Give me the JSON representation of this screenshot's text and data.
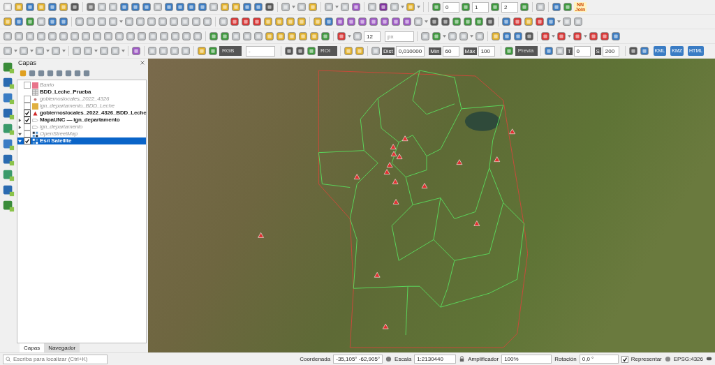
{
  "toolbars": {
    "row_1": {
      "widgets": [
        {
          "kind": "spin",
          "value": "0"
        },
        {
          "kind": "spin",
          "value": "1"
        },
        {
          "kind": "spin",
          "value": "2"
        },
        {
          "kind": "logo",
          "value": "NN Join"
        }
      ]
    },
    "row_3": {
      "widgets": [
        {
          "kind": "spin",
          "value": "12"
        },
        {
          "kind": "combo",
          "value": "px"
        }
      ]
    },
    "row_4": {
      "widgets": [
        {
          "kind": "darkcombo",
          "value": "RGB"
        },
        {
          "kind": "combo",
          "value": "-"
        },
        {
          "kind": "darkbox",
          "value": "ROI"
        },
        {
          "kind": "spin",
          "label": "Dist",
          "value": "0,010000"
        },
        {
          "kind": "spin",
          "label": "Mín",
          "value": "60"
        },
        {
          "kind": "spin",
          "label": "Máx",
          "value": "100"
        },
        {
          "kind": "darkcombo",
          "value": "Previa"
        },
        {
          "kind": "spin",
          "label": "T",
          "value": "0"
        },
        {
          "kind": "spin",
          "label": "S",
          "value": "200"
        },
        {
          "kind": "tagicon",
          "value": "KML"
        },
        {
          "kind": "tagicon",
          "value": "KMZ"
        },
        {
          "kind": "tagicon",
          "value": "HTML"
        }
      ]
    }
  },
  "layers_panel": {
    "title": "Capas",
    "layers": [
      {
        "name": "Barrio",
        "kind": "polygon",
        "color": "#e8748a",
        "visible": false,
        "active": false,
        "expandable": false,
        "selected": false
      },
      {
        "name": "BDD_Leche_Prueba",
        "kind": "table",
        "active": true,
        "expandable": false,
        "selected": false
      },
      {
        "name": "gobiernoslocales_2022_4326",
        "kind": "point",
        "color": "#c07a7a",
        "visible": false,
        "active": false,
        "expandable": false,
        "selected": false
      },
      {
        "name": "ign_departamento_BDD_Leche",
        "kind": "polygon",
        "color": "#e0b040",
        "visible": false,
        "active": false,
        "expandable": false,
        "selected": false
      },
      {
        "name": "gobiernoslocales_2022_4326_BDD_Leche",
        "kind": "triangle",
        "color": "#d02828",
        "visible": true,
        "active": true,
        "expandable": false,
        "selected": false
      },
      {
        "name": "MapaUNC — ign_departamento",
        "kind": "wms",
        "visible": true,
        "active": true,
        "expandable": true,
        "expanded": false,
        "selected": false
      },
      {
        "name": "ign_departamento",
        "kind": "wms",
        "visible": false,
        "active": false,
        "expandable": true,
        "expanded": false,
        "selected": false
      },
      {
        "name": "OpenStreetMap",
        "kind": "tiles",
        "visible": false,
        "active": false,
        "expandable": true,
        "expanded": true,
        "selected": false
      },
      {
        "name": "Esri Satellite",
        "kind": "tiles",
        "visible": true,
        "active": true,
        "expandable": true,
        "expanded": true,
        "selected": true
      }
    ],
    "tabs": [
      {
        "label": "Capas",
        "selected": true
      },
      {
        "label": "Navegador",
        "selected": false
      }
    ]
  },
  "locator": {
    "placeholder": "Escriba para localizar (Ctrl+K)"
  },
  "status_bar": {
    "coordinate": {
      "label": "Coordenada",
      "value": "-35,105° -62,905°"
    },
    "scale": {
      "label": "Escala",
      "value": "1:2130440"
    },
    "magnifier": {
      "label": "Amplificador",
      "value": "100%"
    },
    "rotation": {
      "label": "Rotación",
      "value": "0,0 °"
    },
    "render": {
      "label": "Representar",
      "checked": true
    },
    "crs": "EPSG:4326"
  }
}
